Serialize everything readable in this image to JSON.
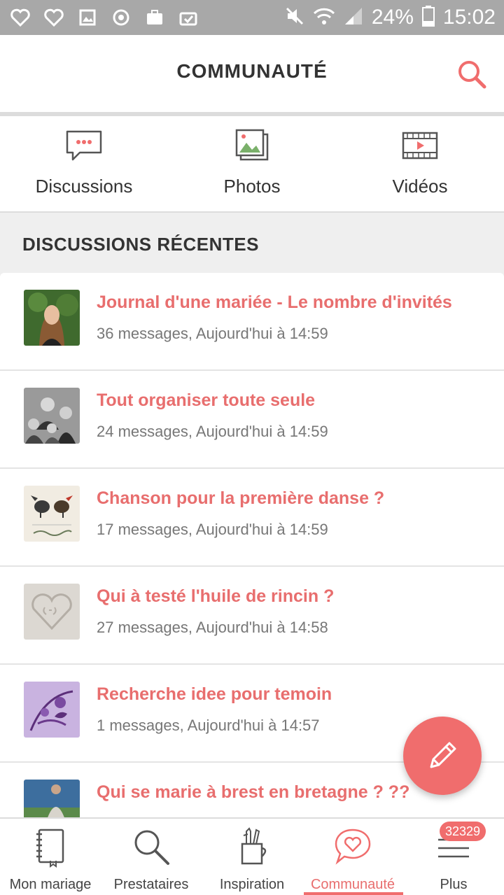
{
  "status_bar": {
    "battery": "24%",
    "time": "15:02"
  },
  "app_bar": {
    "title": "COMMUNAUTÉ"
  },
  "categories": [
    {
      "label": "Discussions",
      "icon": "chat-bubble-icon"
    },
    {
      "label": "Photos",
      "icon": "photos-icon"
    },
    {
      "label": "Vidéos",
      "icon": "video-film-icon"
    }
  ],
  "section": {
    "title": "DISCUSSIONS RÉCENTES"
  },
  "discussions": [
    {
      "title": "Journal d'une mariée - Le nombre d'invités",
      "meta": "36 messages, Aujourd'hui à 14:59"
    },
    {
      "title": "Tout organiser toute seule",
      "meta": "24 messages, Aujourd'hui à 14:59"
    },
    {
      "title": "Chanson pour la première danse ?",
      "meta": "17 messages, Aujourd'hui à 14:59"
    },
    {
      "title": "Qui à testé l'huile de rincin ?",
      "meta": "27 messages, Aujourd'hui à 14:58"
    },
    {
      "title": "Recherche idee pour temoin",
      "meta": "1 messages, Aujourd'hui à 14:57"
    },
    {
      "title": "Qui se marie à brest en bretagne ? ??",
      "meta": ""
    }
  ],
  "bottom_nav": [
    {
      "label": "Mon mariage",
      "icon": "notebook-icon"
    },
    {
      "label": "Prestataires",
      "icon": "magnifier-icon"
    },
    {
      "label": "Inspiration",
      "icon": "pencil-cup-icon"
    },
    {
      "label": "Communauté",
      "icon": "heart-bubble-icon",
      "active": true
    },
    {
      "label": "Plus",
      "icon": "menu-icon",
      "badge": "32329"
    }
  ],
  "colors": {
    "accent": "#f06d6d",
    "title_text": "#e86e6e",
    "status_bar": "#a8a8a8"
  }
}
